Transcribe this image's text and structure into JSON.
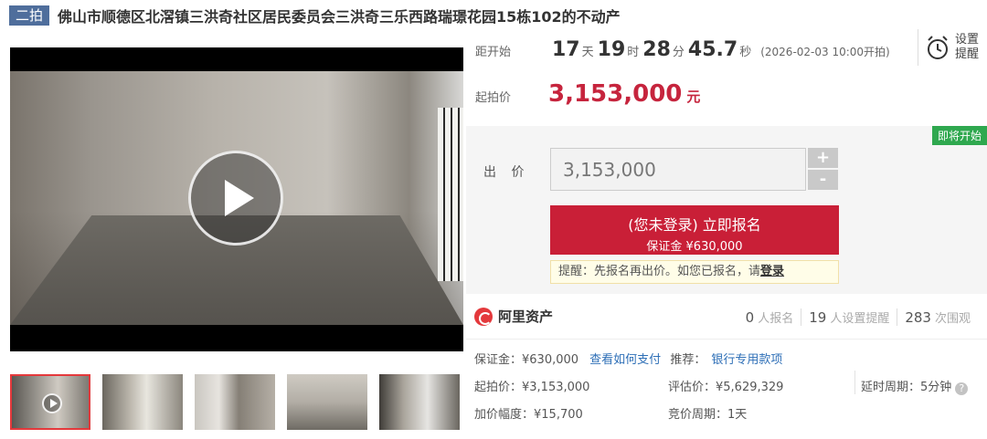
{
  "header": {
    "auction_tag": "二拍",
    "title": "佛山市顺德区北滘镇三洪奇社区居民委员会三洪奇三乐西路瑞璟花园15栋102的不动产"
  },
  "countdown": {
    "label": "距开始",
    "days": "17",
    "days_unit": "天",
    "hours": "19",
    "hours_unit": "时",
    "minutes": "28",
    "minutes_unit": "分",
    "seconds": "45.7",
    "seconds_unit": "秒",
    "start_time": "(2026-02-03 10:00开拍)"
  },
  "reminder": {
    "label": "设置提醒",
    "icon": "alarm-clock-icon"
  },
  "start_price": {
    "label": "起拍价",
    "value": "3,153,000",
    "unit": "元"
  },
  "bid": {
    "status_badge": "即将开始",
    "label": "出 价",
    "input_value": "3,153,000",
    "plus": "+",
    "minus": "-",
    "signup_main": "(您未登录) 立即报名",
    "signup_sub": "保证金 ¥630,000",
    "tip_prefix": "提醒：先报名再出价。如您已报名，请",
    "tip_link": "登录"
  },
  "brand": {
    "name": "阿里资产",
    "logo": "ali-asset-logo"
  },
  "stats": [
    {
      "num": "0",
      "label": "人报名"
    },
    {
      "num": "19",
      "label": "人设置提醒"
    },
    {
      "num": "283",
      "label": "次围观"
    }
  ],
  "details": {
    "deposit": "保证金：¥630,000",
    "how_to_pay": "查看如何支付",
    "recommend_label": "推荐：",
    "recommend_link": "银行专用款项",
    "start_price": "起拍价：¥3,153,000",
    "assessed_price": "评估价：¥5,629,329",
    "delay_period": "延时周期：5分钟",
    "increment": "加价幅度：¥15,700",
    "bid_period": "竞价周期：1天"
  },
  "colors": {
    "accent_red": "#c6243d",
    "tag_blue": "#4f6e9c",
    "badge_green": "#2fa84f",
    "link_blue": "#2e6fb7"
  }
}
